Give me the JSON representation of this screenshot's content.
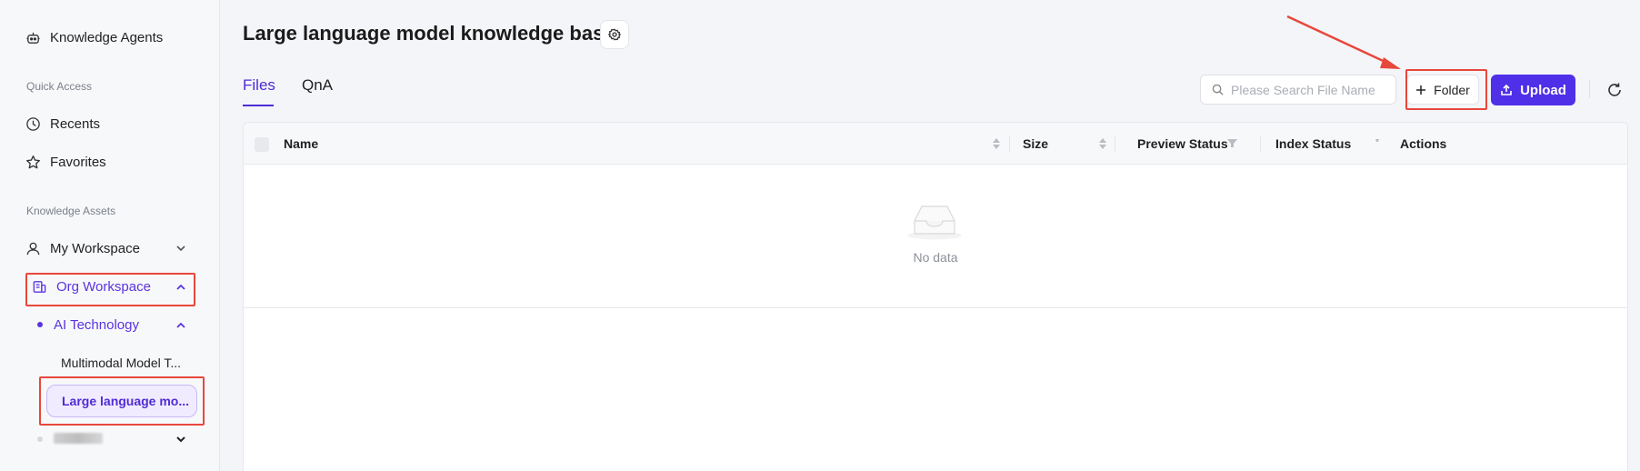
{
  "sidebar": {
    "knowledge_agents": "Knowledge Agents",
    "quick_access_label": "Quick Access",
    "recents": "Recents",
    "favorites": "Favorites",
    "knowledge_assets_label": "Knowledge Assets",
    "my_workspace": "My Workspace",
    "org_workspace": "Org Workspace",
    "ai_technology": "AI Technology",
    "multimodal": "Multimodal Model T...",
    "large_language": "Large language mo..."
  },
  "header": {
    "title": "Large language model knowledge base"
  },
  "tabs": [
    {
      "label": "Files",
      "active": true
    },
    {
      "label": "QnA",
      "active": false
    }
  ],
  "toolbar": {
    "search_placeholder": "Please Search File Name",
    "folder_label": "Folder",
    "upload_label": "Upload"
  },
  "table": {
    "columns": [
      "Name",
      "Size",
      "Preview Status",
      "Index Status",
      "Actions"
    ],
    "rows": [],
    "empty_text": "No data"
  },
  "colors": {
    "accent": "#4f2fe8",
    "highlight": "#e8473c"
  },
  "icons": [
    "robot-icon",
    "clock-icon",
    "star-icon",
    "user-icon",
    "building-icon",
    "gear-icon",
    "search-icon",
    "plus-icon",
    "upload-icon",
    "refresh-icon",
    "inbox-icon"
  ]
}
